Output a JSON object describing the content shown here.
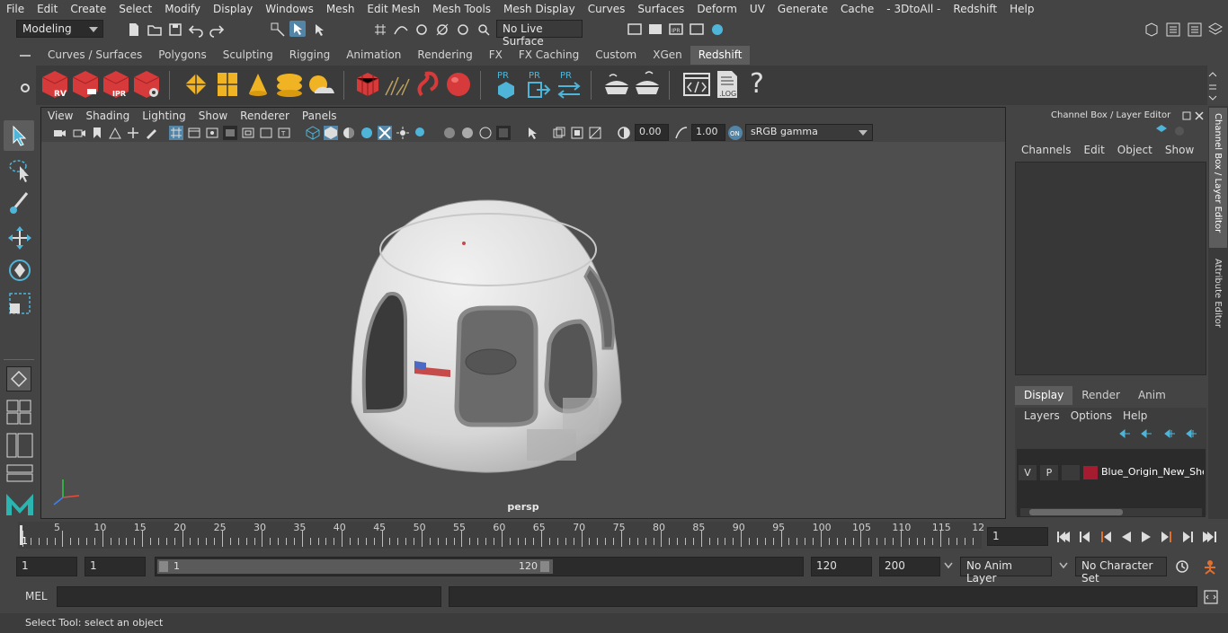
{
  "menubar": {
    "items": [
      "File",
      "Edit",
      "Create",
      "Select",
      "Modify",
      "Display",
      "Windows",
      "Mesh",
      "Edit Mesh",
      "Mesh Tools",
      "Mesh Display",
      "Curves",
      "Surfaces",
      "Deform",
      "UV",
      "Generate",
      "Cache",
      "- 3DtoAll -",
      "Redshift",
      "Help"
    ]
  },
  "status_line": {
    "mode": "Modeling",
    "live_surface": "No Live Surface"
  },
  "shelf_tabs": [
    "Curves / Surfaces",
    "Polygons",
    "Sculpting",
    "Rigging",
    "Animation",
    "Rendering",
    "FX",
    "FX Caching",
    "Custom",
    "XGen",
    "Redshift"
  ],
  "shelf_active_tab": "Redshift",
  "shelf_icons": {
    "rv": "RV",
    "ipr": "IPR",
    "pr": "PR",
    "log": ".LOG",
    "help": "?"
  },
  "viewport": {
    "menu": [
      "View",
      "Shading",
      "Lighting",
      "Show",
      "Renderer",
      "Panels"
    ],
    "exposure": "0.00",
    "gamma": "1.00",
    "color_space": "sRGB gamma",
    "camera_label": "persp"
  },
  "channel_box": {
    "title": "Channel Box / Layer Editor",
    "menu": [
      "Channels",
      "Edit",
      "Object",
      "Show"
    ]
  },
  "layer_editor": {
    "tabs": [
      "Display",
      "Render",
      "Anim"
    ],
    "active_tab": "Display",
    "menu": [
      "Layers",
      "Options",
      "Help"
    ],
    "layer": {
      "v": "V",
      "p": "P",
      "name": "Blue_Origin_New_Shepard",
      "color": "#a51c30"
    }
  },
  "side_tabs": [
    "Channel Box / Layer Editor",
    "Attribute Editor"
  ],
  "timeline": {
    "ticks": [
      "5",
      "10",
      "15",
      "20",
      "25",
      "30",
      "35",
      "40",
      "45",
      "50",
      "55",
      "60",
      "65",
      "70",
      "75",
      "80",
      "85",
      "90",
      "95",
      "100",
      "105",
      "110",
      "115",
      "12"
    ],
    "start_label": "1",
    "current_frame": "1"
  },
  "range": {
    "start": "1",
    "playback_start": "1",
    "slider_start": "1",
    "slider_end": "120",
    "playback_end": "120",
    "end": "200",
    "anim_layer": "No Anim Layer",
    "character_set": "No Character Set"
  },
  "command_line": {
    "label": "MEL"
  },
  "help_line": {
    "text": "Select Tool: select an object"
  },
  "colors": {
    "accent": "#5285a6",
    "red_icon": "#d63a3a",
    "yellow_icon": "#f0b323"
  }
}
